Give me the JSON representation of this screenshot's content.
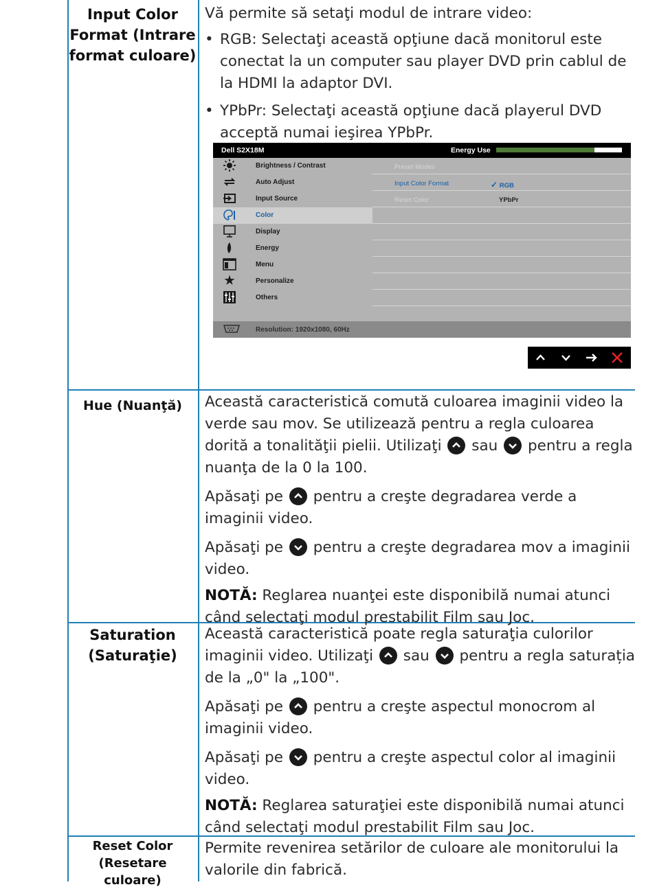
{
  "rows": [
    {
      "label": "Input Color Format (Intrare format culoare)",
      "label_lines": [
        "Input Color",
        "Format (Intrare",
        "format culoare)"
      ],
      "intro": "Vă permite să setaţi modul de intrare video:",
      "bullets": [
        "RGB: Selectaţi această opţiune dacă monitorul este conectat la un computer sau player DVD prin cablul de la HDMI la adaptor DVI.",
        "YPbPr: Selectaţi această opţiune dacă playerul DVD acceptă numai ieşirea YPbPr."
      ]
    },
    {
      "label": "Hue (Nuanţă)",
      "p1_a": "Această caracteristică comută culoarea imaginii video la verde sau mov. Se utilizează pentru a regla culoarea dorită a tonalităţii pielii. Utilizaţi",
      "p1_b": "sau",
      "p1_c": "pentru a regla nuanţa de la 0 la 100.",
      "p2_a": "Apăsaţi pe",
      "p2_b": "pentru a creşte degradarea verde a imaginii video.",
      "p3_a": "Apăsaţi pe",
      "p3_b": "pentru a creşte degradarea mov a imaginii video.",
      "note_label": "NOTĂ:",
      "note_text": "Reglarea nuanţei este disponibilă numai atunci când selectaţi modul prestabilit Film sau Joc."
    },
    {
      "label": "Saturation (Saturaţie)",
      "label_lines": [
        "Saturation",
        "(Saturaţie)"
      ],
      "p1_a": "Această caracteristică poate regla saturaţia culorilor imaginii video. Utilizaţi",
      "p1_b": "sau",
      "p1_c": "pentru a regla saturația de la „0\" la „100\".",
      "p2_a": "Apăsaţi pe",
      "p2_b": "pentru a creşte aspectul monocrom al imaginii video.",
      "p3_a": "Apăsaţi pe",
      "p3_b": "pentru a creşte aspectul color al imaginii video.",
      "note_label": "NOTĂ:",
      "note_text": "Reglarea saturaţiei este disponibilă numai atunci când selectaţi modul prestabilit Film sau Joc."
    },
    {
      "label": "Reset Color (Resetare culoare)",
      "label_lines": [
        "Reset Color",
        "(Resetare",
        "culoare)"
      ],
      "text": "Permite revenirea setărilor de culoare ale monitorului la valorile din fabrică."
    }
  ],
  "osd": {
    "model": "Dell S2X18M",
    "energy_label": "Energy Use",
    "energy_level": 0.78,
    "menu": [
      {
        "label": "Brightness / Contrast",
        "icon": "sun-icon"
      },
      {
        "label": "Auto Adjust",
        "icon": "arrows-cycle-icon"
      },
      {
        "label": "Input Source",
        "icon": "input-source-icon"
      },
      {
        "label": "Color",
        "icon": "color-palette-icon",
        "active": true
      },
      {
        "label": "Display",
        "icon": "monitor-icon"
      },
      {
        "label": "Energy",
        "icon": "leaf-icon"
      },
      {
        "label": "Menu",
        "icon": "menu-window-icon"
      },
      {
        "label": "Personalize",
        "icon": "star-icon"
      },
      {
        "label": "Others",
        "icon": "sliders-icon"
      }
    ],
    "submenu": [
      {
        "label": "Preset Modes",
        "value": "",
        "state": "disabled"
      },
      {
        "label": "Input Color Format",
        "value": "RGB",
        "state": "selected",
        "checked": true
      },
      {
        "label": "Reset Color",
        "value": "YPbPr",
        "state": "disabled"
      }
    ],
    "footer": "Resolution: 1920x1080, 60Hz",
    "nav_buttons": [
      "up-icon",
      "down-icon",
      "right-arrow-icon",
      "close-icon"
    ],
    "colors": {
      "accent": "#1a5fa7",
      "energy_bar": "#4e7b38",
      "close": "#e8232a",
      "border": "#1f7fb6"
    }
  }
}
